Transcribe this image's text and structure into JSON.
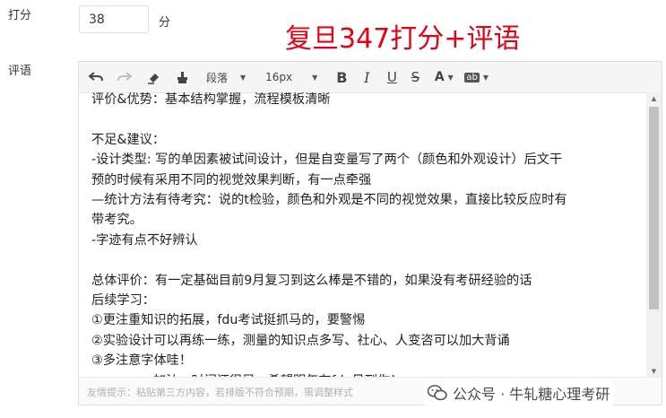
{
  "score": {
    "label": "打分",
    "value": "38",
    "unit": "分"
  },
  "banner": "复旦347打分+评语",
  "comment": {
    "label": "评语",
    "toolbar": {
      "paragraph": "段落",
      "font_size": "16px",
      "bold": "B",
      "italic": "I",
      "underline": "U",
      "strike": "S",
      "font_color": "A",
      "bg_color": "ab"
    },
    "lines": [
      "评价&优势：基本结构掌握，流程模板清晰",
      "",
      "不足&建议：",
      "-设计类型: 写的单因素被试间设计，但是自变量写了两个（颜色和外观设计）后文干",
      "预的时候有采用不同的视觉效果判断，有一点牵强",
      "—统计方法有待考究：说的t检验，颜色和外观是不同的视觉效果，直接比较反应时有",
      "带考究。",
      "-字迹有点不好辨认",
      "",
      "总体评价：有一定基础目前9月复习到这么棒是不错的，如果没有考研经验的话",
      "后续学习：",
      "①更注重知识的拓展，fdu考试挺抓马的，要警惕",
      "②实验设计可以再练一练，测量的知识点多写、社心、人变咨可以加大背诵",
      "③多注意字体哇！",
      "anyway，加油，时间还很早，希望明年在fdu见到你！"
    ],
    "hint": "友情提示：粘贴第三方内容，若排版不符合预期，需调整样式"
  },
  "watermark": "公众号 · 牛轧糖心理考研"
}
